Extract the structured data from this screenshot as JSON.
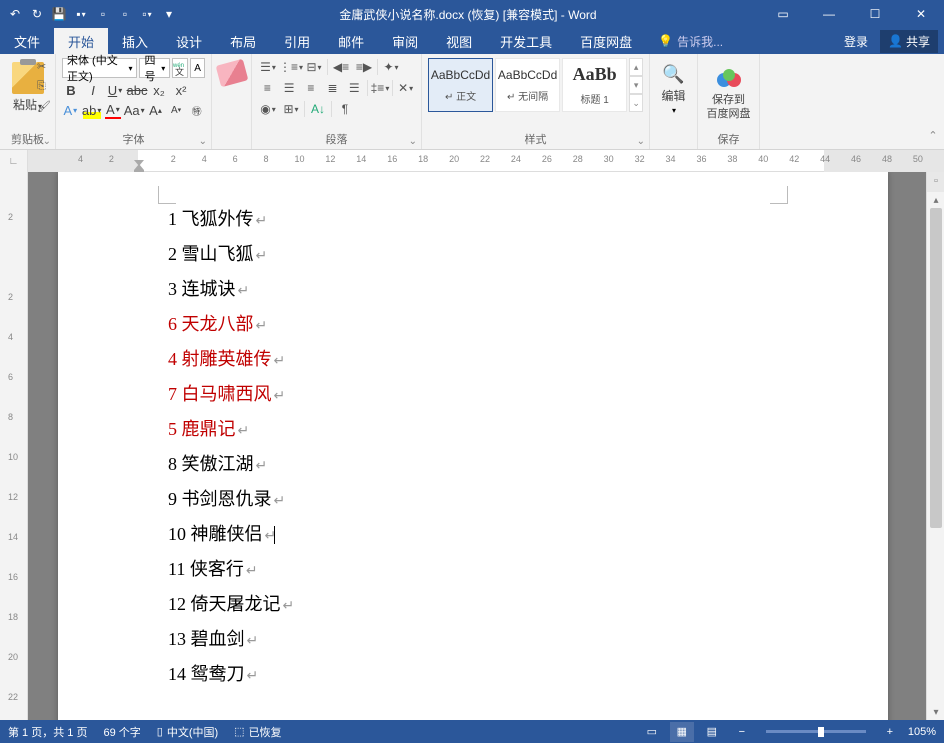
{
  "titlebar": {
    "title": "金庸武侠小说名称.docx (恢复) [兼容模式] - Word"
  },
  "menu": {
    "file": "文件",
    "home": "开始",
    "insert": "插入",
    "design": "设计",
    "layout": "布局",
    "references": "引用",
    "mail": "邮件",
    "review": "审阅",
    "view": "视图",
    "dev": "开发工具",
    "baidu": "百度网盘",
    "tell": "告诉我...",
    "login": "登录",
    "share": "共享"
  },
  "ribbon": {
    "paste": "粘贴",
    "clipboard": "剪贴板",
    "font_name": "宋体 (中文正文)",
    "font_size": "四号",
    "wen": "wén",
    "A_box": "A",
    "font_label": "字体",
    "para_label": "段落",
    "style_preview": "AaBbCcDd",
    "style_preview_big": "AaBb",
    "style_normal": "↵ 正文",
    "style_nospacing": "↵ 无间隔",
    "style_heading1": "标题 1",
    "styles_label": "样式",
    "edit_label": "编辑",
    "baidu_save": "保存到",
    "baidu_save2": "百度网盘",
    "baidu_label": "保存"
  },
  "document": {
    "lines": [
      {
        "text": "1 飞狐外传",
        "red": false
      },
      {
        "text": "2 雪山飞狐",
        "red": false
      },
      {
        "text": "3 连城诀",
        "red": false
      },
      {
        "text": "6 天龙八部",
        "red": true
      },
      {
        "text": "4 射雕英雄传",
        "red": true
      },
      {
        "text": "7 白马啸西风",
        "red": true
      },
      {
        "text": "5 鹿鼎记",
        "red": true
      },
      {
        "text": "8 笑傲江湖",
        "red": false
      },
      {
        "text": "9 书剑恩仇录",
        "red": false
      },
      {
        "text": "10 神雕侠侣",
        "red": false,
        "cursor": true
      },
      {
        "text": "11 侠客行",
        "red": false
      },
      {
        "text": "12 倚天屠龙记",
        "red": false
      },
      {
        "text": "13 碧血剑",
        "red": false
      },
      {
        "text": "14 鸳鸯刀",
        "red": false
      }
    ]
  },
  "ruler_h": [
    "4",
    "2",
    "",
    "2",
    "4",
    "6",
    "8",
    "10",
    "12",
    "14",
    "16",
    "18",
    "20",
    "22",
    "24",
    "26",
    "28",
    "30",
    "32",
    "34",
    "36",
    "38",
    "40",
    "42",
    "44",
    "46",
    "48",
    "50"
  ],
  "ruler_v": [
    "",
    "2",
    "",
    "2",
    "4",
    "6",
    "8",
    "10",
    "12",
    "14",
    "16",
    "18",
    "20",
    "22"
  ],
  "status": {
    "page": "第 1 页，共 1 页",
    "words": "69 个字",
    "lang": "中文(中国)",
    "recovered": "已恢复",
    "zoom": "105%"
  }
}
